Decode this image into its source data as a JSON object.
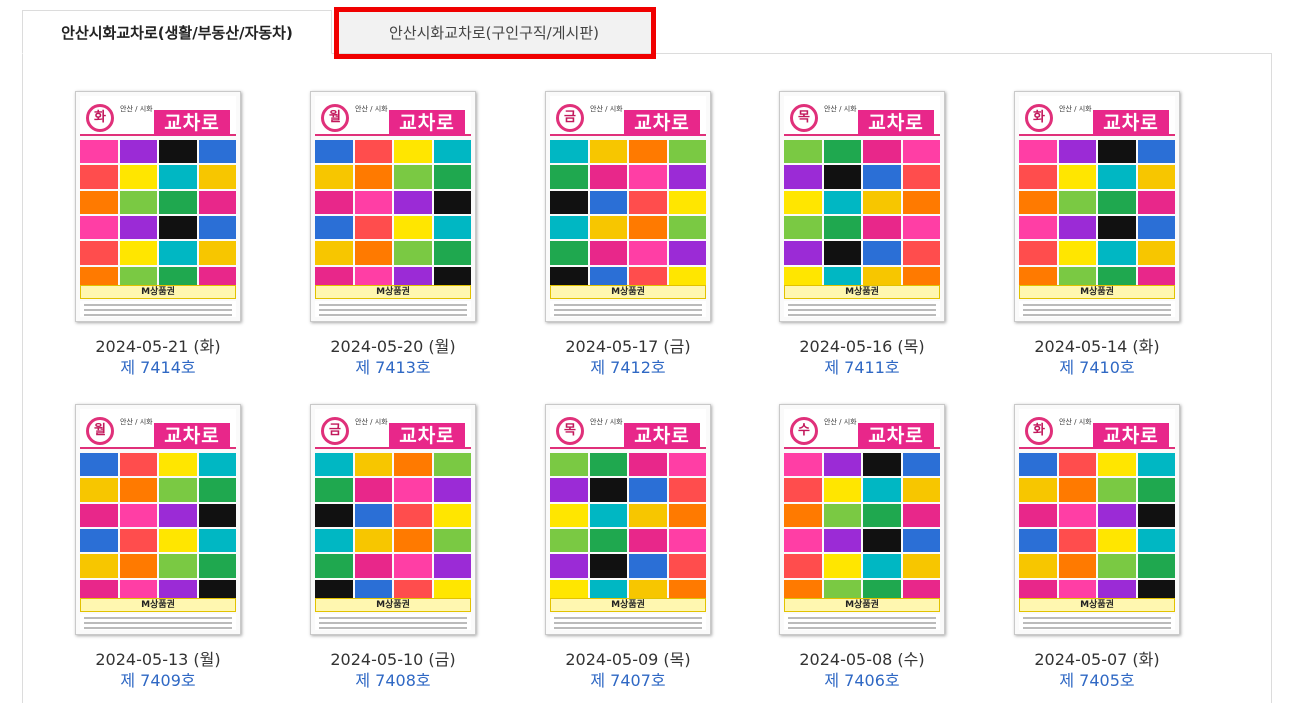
{
  "tabs": [
    {
      "label": "안산시화교차로(생활/부동산/자동차)",
      "active": true
    },
    {
      "label": "안산시화교차로(구인구직/게시판)",
      "active": false
    }
  ],
  "cover": {
    "logo": "교차로",
    "city": "안산 / 시화",
    "ad": "M상품권"
  },
  "issues": [
    {
      "date": "2024-05-21 (화)",
      "number": "제 7414호",
      "day": "화"
    },
    {
      "date": "2024-05-20 (월)",
      "number": "제 7413호",
      "day": "월"
    },
    {
      "date": "2024-05-17 (금)",
      "number": "제 7412호",
      "day": "금"
    },
    {
      "date": "2024-05-16 (목)",
      "number": "제 7411호",
      "day": "목"
    },
    {
      "date": "2024-05-14 (화)",
      "number": "제 7410호",
      "day": "화"
    },
    {
      "date": "2024-05-13 (월)",
      "number": "제 7409호",
      "day": "월"
    },
    {
      "date": "2024-05-10 (금)",
      "number": "제 7408호",
      "day": "금"
    },
    {
      "date": "2024-05-09 (목)",
      "number": "제 7407호",
      "day": "목"
    },
    {
      "date": "2024-05-08 (수)",
      "number": "제 7406호",
      "day": "수"
    },
    {
      "date": "2024-05-07 (화)",
      "number": "제 7405호",
      "day": "화"
    }
  ],
  "colors": {
    "accent": "#e8278a",
    "link": "#2f68c4",
    "highlight": "#f00000"
  }
}
